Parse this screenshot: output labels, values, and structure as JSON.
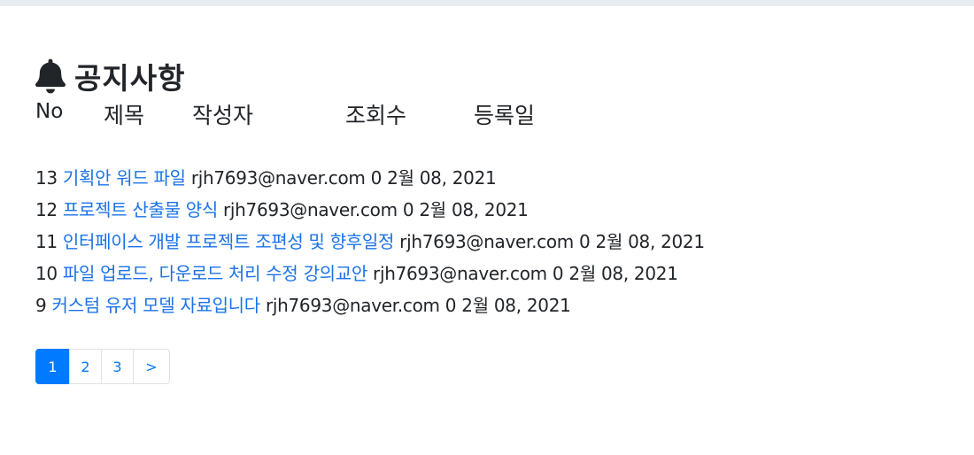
{
  "header": {
    "title": "공지사항",
    "icon": "bell-icon"
  },
  "columns": {
    "no": "No",
    "title": "제목",
    "author": "작성자",
    "views": "조회수",
    "date": "등록일"
  },
  "notices": [
    {
      "no": "13",
      "title": "기획안 워드 파일",
      "author": "rjh7693@naver.com",
      "views": "0",
      "date": "2월 08, 2021"
    },
    {
      "no": "12",
      "title": "프로젝트 산출물 양식",
      "author": "rjh7693@naver.com",
      "views": "0",
      "date": "2월 08, 2021"
    },
    {
      "no": "11",
      "title": "인터페이스 개발 프로젝트 조편성 및 향후일정",
      "author": "rjh7693@naver.com",
      "views": "0",
      "date": "2월 08, 2021"
    },
    {
      "no": "10",
      "title": "파일 업로드, 다운로드 처리 수정 강의교안",
      "author": "rjh7693@naver.com",
      "views": "0",
      "date": "2월 08, 2021"
    },
    {
      "no": "9",
      "title": "커스텀 유저 모델 자료입니다",
      "author": "rjh7693@naver.com",
      "views": "0",
      "date": "2월 08, 2021"
    }
  ],
  "pagination": {
    "pages": [
      "1",
      "2",
      "3"
    ],
    "active": "1",
    "next": ">"
  },
  "colors": {
    "link": "#1a73e8",
    "primary": "#007bff",
    "topbar": "#e9ecef"
  }
}
